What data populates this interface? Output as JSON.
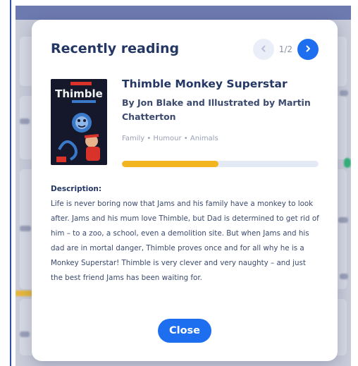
{
  "modal": {
    "title": "Recently reading",
    "pager": {
      "current": "1",
      "total": "2",
      "label": "1/2"
    },
    "close_label": "Close"
  },
  "book": {
    "title": "Thimble Monkey Superstar",
    "author": "By Jon Blake and Illustrated by Martin Chatterton",
    "tags": "Family • Humour • Animals",
    "progress_fraction": 0.49,
    "cover": {
      "title_text": "Thimble",
      "colors": {
        "background": "#15172b",
        "title": "#f2f2f2",
        "accent_red": "#d8322a",
        "accent_blue": "#3a78c8"
      }
    }
  },
  "description": {
    "label": "Description:",
    "text": "Life is never boring now that Jams and his family have a monkey to look after. Jams and his mum love Thimble, but Dad is determined to get rid of him – to a zoo, a school, even a demolition site. But when Jams and his dad are in mortal danger, Thimble proves once and for all why he is a Monkey Superstar! Thimble is very clever and very naughty – and just the best friend Jams has been waiting for."
  },
  "icons": {
    "prev": "chevron-left-icon",
    "next": "chevron-right-icon"
  },
  "colors": {
    "primary": "#1e6ff0",
    "heading": "#243764",
    "progress_fill": "#f3b51f",
    "progress_track": "#e4eaf5",
    "backdrop": "#c9ccd9"
  }
}
